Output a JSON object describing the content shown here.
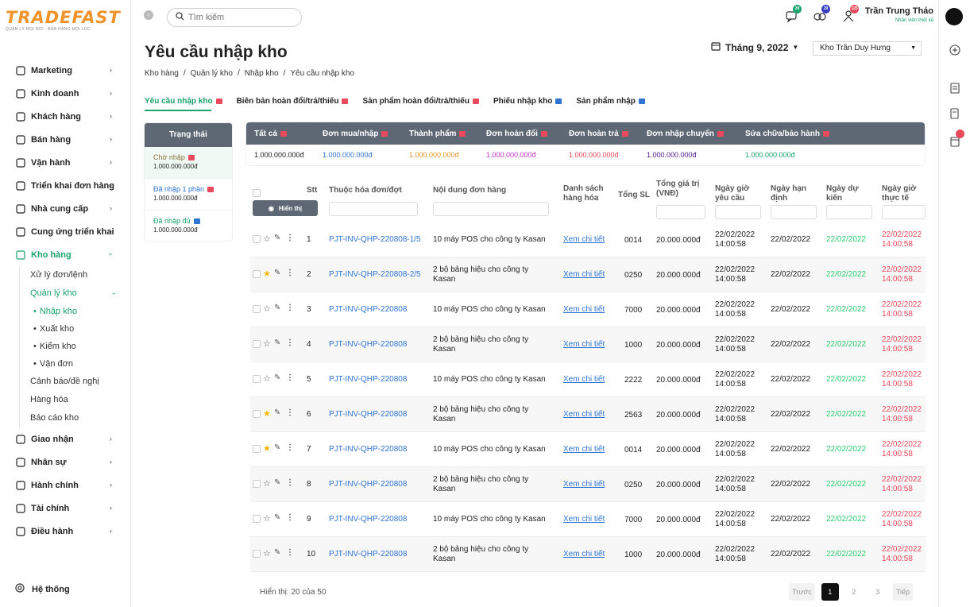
{
  "logo": {
    "brand": "TRADEFAST",
    "tagline": "QUẢN LÝ MỌI NƠI · BÁN HÀNG MỌI LÚC"
  },
  "sidebar": {
    "items": [
      {
        "label": "Marketing",
        "icon": "megaphone-icon"
      },
      {
        "label": "Kinh doanh",
        "icon": "chart-icon"
      },
      {
        "label": "Khách hàng",
        "icon": "handshake-icon"
      },
      {
        "label": "Bán hàng",
        "icon": "store-icon"
      },
      {
        "label": "Vận hành",
        "icon": "gears-icon"
      },
      {
        "label": "Triển khai đơn hàng",
        "icon": "clipboard-icon"
      },
      {
        "label": "Nhà cung cấp",
        "icon": "truck-icon"
      },
      {
        "label": "Cung ứng triển khai",
        "icon": "cart-icon"
      },
      {
        "label": "Kho hàng",
        "icon": "warehouse-icon"
      }
    ],
    "kho_sub": [
      {
        "label": "Xử lý đơn/lệnh"
      },
      {
        "label": "Quản lý kho"
      }
    ],
    "kho_leaf": [
      {
        "label": "Nhập kho"
      },
      {
        "label": "Xuất kho"
      },
      {
        "label": "Kiểm kho"
      },
      {
        "label": "Vận đơn"
      }
    ],
    "kho_sub2": [
      {
        "label": "Cảnh báo/đề nghị"
      },
      {
        "label": "Hàng hóa"
      },
      {
        "label": "Báo cáo kho"
      }
    ],
    "items2": [
      {
        "label": "Giao nhận",
        "icon": "delivery-icon"
      },
      {
        "label": "Nhân sự",
        "icon": "people-icon"
      },
      {
        "label": "Hành chính",
        "icon": "building-icon"
      },
      {
        "label": "Tài chính",
        "icon": "coin-icon"
      },
      {
        "label": "Điều hành",
        "icon": "org-icon"
      }
    ],
    "system": "Hệ thống"
  },
  "search": {
    "placeholder": "Tìm kiếm"
  },
  "notifications": {
    "chat": "29",
    "money": "29",
    "person": "125"
  },
  "user": {
    "name": "Trần Trung Thảo",
    "role": "Nhân viên thiết kế"
  },
  "page": {
    "title": "Yêu cầu nhập kho",
    "breadcrumb": [
      "Kho hàng",
      "Quản lý kho",
      "Nhập kho",
      "Yêu cầu nhập kho"
    ],
    "month": "Tháng 9, 2022",
    "warehouse": "Kho Trần Duy Hưng"
  },
  "tabs": [
    {
      "label": "Yêu cầu nhập kho",
      "color": "#e8495b"
    },
    {
      "label": "Biên bản hoàn đổi/trả/thiếu",
      "color": "#e8495b"
    },
    {
      "label": "Sản phẩm hoàn đổi/trả/thiếu",
      "color": "#e8495b"
    },
    {
      "label": "Phiếu nhập kho",
      "color": "#2f74d0"
    },
    {
      "label": "Sản phẩm nhập",
      "color": "#2f74d0"
    }
  ],
  "status_panel": {
    "header": "Trạng thái",
    "rows": [
      {
        "label": "Chờ nhập",
        "amount": "1.000.000.000đ",
        "color": "#8a6d3b",
        "badge": "#e8495b"
      },
      {
        "label": "Đã nhập 1 phần",
        "amount": "1.000.000.000đ",
        "color": "#2f74d0",
        "badge": "#e8495b"
      },
      {
        "label": "Đã nhập đủ",
        "amount": "1.000.000.000đ",
        "color": "#1aa36b",
        "badge": "#2f74d0"
      }
    ]
  },
  "summary": [
    {
      "label": "Tất cả",
      "value": "1.000.000.000đ",
      "color": "#222"
    },
    {
      "label": "Đơn mua/nhập",
      "value": "1.000.000.000đ",
      "color": "#2f74d0"
    },
    {
      "label": "Thành phẩm",
      "value": "1.000.000.000đ",
      "color": "#e8962b"
    },
    {
      "label": "Đơn hoàn đổi",
      "value": "1.000.000.000đ",
      "color": "#c233c8"
    },
    {
      "label": "Đơn hoàn trả",
      "value": "1.000.000.000đ",
      "color": "#e8495b"
    },
    {
      "label": "Đơn nhập chuyển",
      "value": "1.000.000.000đ",
      "color": "#4a148c"
    },
    {
      "label": "Sửa chữa/bảo hành",
      "value": "1.000.000.000đ",
      "color": "#1aa36b"
    }
  ],
  "table": {
    "show_button": "Hiển thị",
    "headers": {
      "stt": "Stt",
      "invoice": "Thuộc hóa đơn/đợt",
      "content": "Nội dung đơn hàng",
      "goods": "Danh sách hàng hóa",
      "qty": "Tổng SL",
      "total": "Tổng giá trị (VNĐ)",
      "req": "Ngày giờ yêu cầu",
      "due": "Ngày hạn định",
      "exp": "Ngày dự kiến",
      "act": "Ngày giờ thực tế"
    },
    "rows": [
      {
        "stt": "1",
        "starred": false,
        "invoice": "PJT-INV-QHP-220808-1/5",
        "content": "10 máy POS cho công ty Kasan",
        "link": "Xem chi tiết",
        "qty": "0014",
        "total": "20.000.000đ",
        "req_date": "22/02/2022",
        "req_time": "14:00:58",
        "due": "22/02/2022",
        "exp": "22/02/2022",
        "act_date": "22/02/2022",
        "act_time": "14:00:58"
      },
      {
        "stt": "2",
        "starred": true,
        "invoice": "PJT-INV-QHP-220808-2/5",
        "content": "2 bộ bảng hiệu cho công ty Kasan",
        "link": "Xem chi tiết",
        "qty": "0250",
        "total": "20.000.000đ",
        "req_date": "22/02/2022",
        "req_time": "14:00:58",
        "due": "22/02/2022",
        "exp": "22/02/2022",
        "act_date": "22/02/2022",
        "act_time": "14:00:58"
      },
      {
        "stt": "3",
        "starred": false,
        "invoice": "PJT-INV-QHP-220808",
        "content": "10 máy POS cho công ty Kasan",
        "link": "Xem chi tiết",
        "qty": "7000",
        "total": "20.000.000đ",
        "req_date": "22/02/2022",
        "req_time": "14:00:58",
        "due": "22/02/2022",
        "exp": "22/02/2022",
        "act_date": "22/02/2022",
        "act_time": "14:00:58"
      },
      {
        "stt": "4",
        "starred": false,
        "invoice": "PJT-INV-QHP-220808",
        "content": "2 bộ bảng hiệu cho công ty Kasan",
        "link": "Xem chi tiết",
        "qty": "1000",
        "total": "20.000.000đ",
        "req_date": "22/02/2022",
        "req_time": "14:00:58",
        "due": "22/02/2022",
        "exp": "22/02/2022",
        "act_date": "22/02/2022",
        "act_time": "14:00:58"
      },
      {
        "stt": "5",
        "starred": false,
        "invoice": "PJT-INV-QHP-220808",
        "content": "10 máy POS cho công ty Kasan",
        "link": "Xem chi tiết",
        "qty": "2222",
        "total": "20.000.000đ",
        "req_date": "22/02/2022",
        "req_time": "14:00:58",
        "due": "22/02/2022",
        "exp": "22/02/2022",
        "act_date": "22/02/2022",
        "act_time": "14:00:58"
      },
      {
        "stt": "6",
        "starred": true,
        "invoice": "PJT-INV-QHP-220808",
        "content": "2 bộ bảng hiệu cho công ty Kasan",
        "link": "Xem chi tiết",
        "qty": "2563",
        "total": "20.000.000đ",
        "req_date": "22/02/2022",
        "req_time": "14:00:58",
        "due": "22/02/2022",
        "exp": "22/02/2022",
        "act_date": "22/02/2022",
        "act_time": "14:00:58"
      },
      {
        "stt": "7",
        "starred": true,
        "invoice": "PJT-INV-QHP-220808",
        "content": "10 máy POS cho công ty Kasan",
        "link": "Xem chi tiết",
        "qty": "0014",
        "total": "20.000.000đ",
        "req_date": "22/02/2022",
        "req_time": "14:00:58",
        "due": "22/02/2022",
        "exp": "22/02/2022",
        "act_date": "22/02/2022",
        "act_time": "14:00:58"
      },
      {
        "stt": "8",
        "starred": false,
        "invoice": "PJT-INV-QHP-220808",
        "content": "2 bộ bảng hiệu cho công ty Kasan",
        "link": "Xem chi tiết",
        "qty": "0250",
        "total": "20.000.000đ",
        "req_date": "22/02/2022",
        "req_time": "14:00:58",
        "due": "22/02/2022",
        "exp": "22/02/2022",
        "act_date": "22/02/2022",
        "act_time": "14:00:58"
      },
      {
        "stt": "9",
        "starred": false,
        "invoice": "PJT-INV-QHP-220808",
        "content": "10 máy POS cho công ty Kasan",
        "link": "Xem chi tiết",
        "qty": "7000",
        "total": "20.000.000đ",
        "req_date": "22/02/2022",
        "req_time": "14:00:58",
        "due": "22/02/2022",
        "exp": "22/02/2022",
        "act_date": "22/02/2022",
        "act_time": "14:00:58"
      },
      {
        "stt": "10",
        "starred": false,
        "invoice": "PJT-INV-QHP-220808",
        "content": "2 bộ bảng hiệu cho công ty Kasan",
        "link": "Xem chi tiết",
        "qty": "1000",
        "total": "20.000.000đ",
        "req_date": "22/02/2022",
        "req_time": "14:00:58",
        "due": "22/02/2022",
        "exp": "22/02/2022",
        "act_date": "22/02/2022",
        "act_time": "14:00:58"
      }
    ]
  },
  "footer": {
    "showing": "Hiển thị: 20 của 50",
    "prev": "Trước",
    "pages": [
      "1",
      "2",
      "3"
    ],
    "next": "Tiếp"
  }
}
